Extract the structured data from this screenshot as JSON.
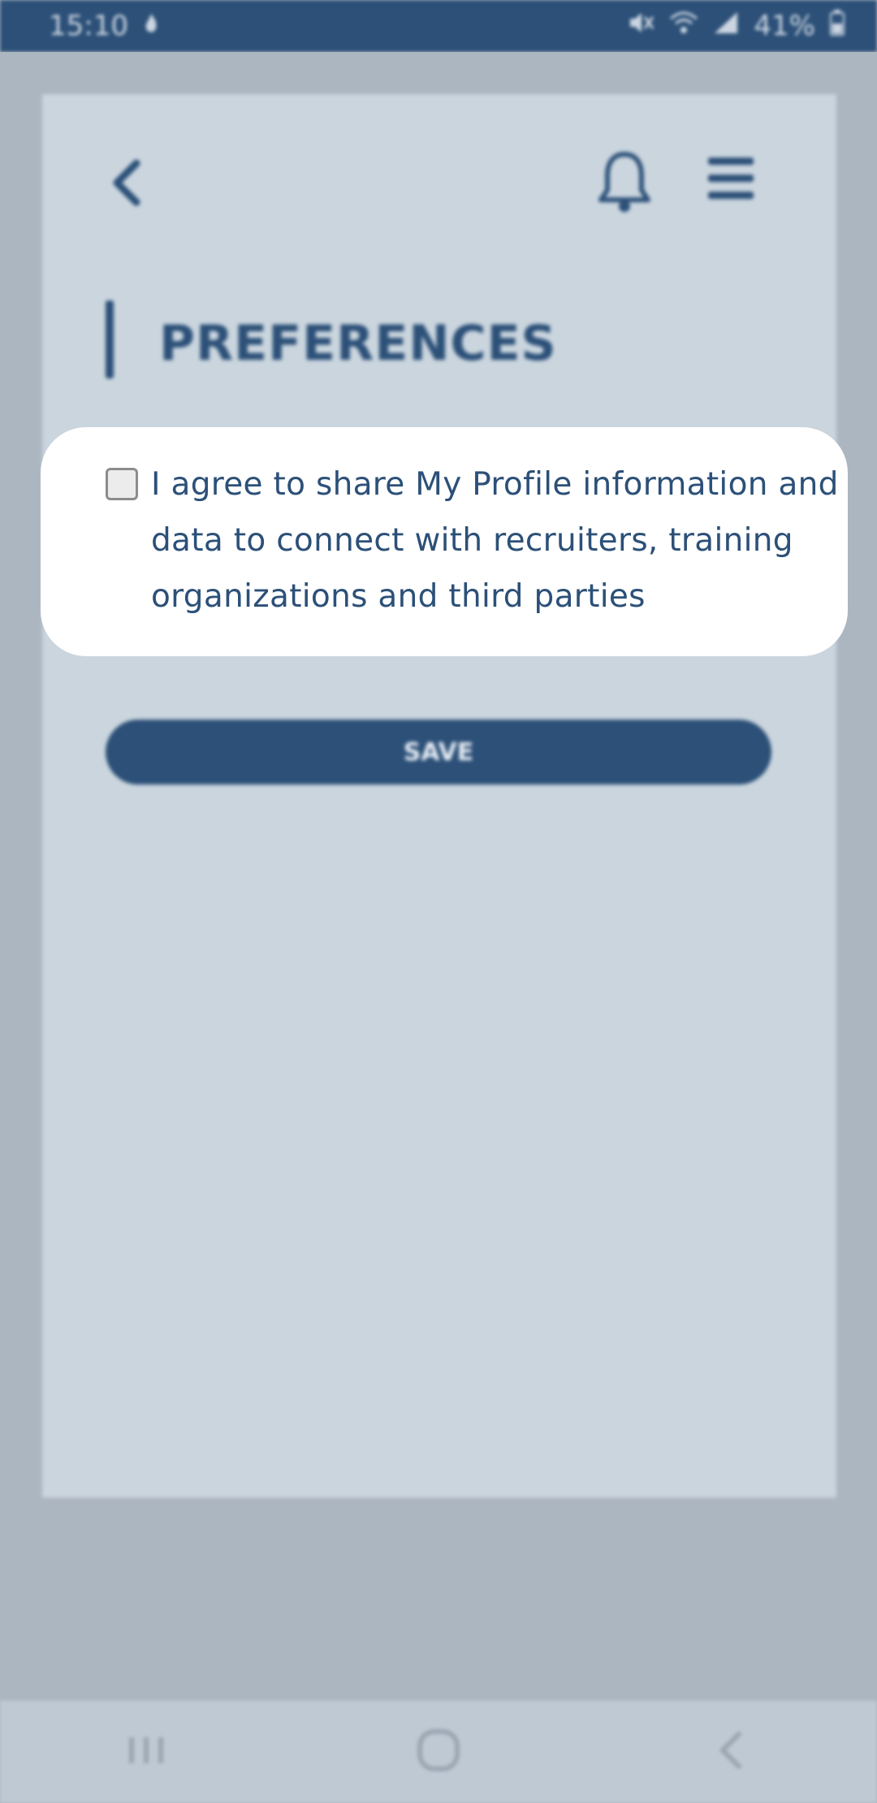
{
  "status_bar": {
    "time": "15:10",
    "battery": "41%"
  },
  "header": {
    "back_icon": "chevron-left-icon",
    "notification_icon": "bell-icon",
    "menu_icon": "hamburger-menu-icon"
  },
  "page": {
    "title": "PREFERENCES"
  },
  "consent": {
    "checked": false,
    "label": "I agree to share My Profile information and data to connect with recruiters, training organizations and third parties"
  },
  "actions": {
    "save_label": "SAVE"
  },
  "navigation_bar": {
    "recents_icon": "recents-icon",
    "home_icon": "home-icon",
    "back_icon": "back-icon"
  },
  "colors": {
    "primary": "#2c5078",
    "dim_overlay": "#acb6c0",
    "card": "#cad5de",
    "highlight": "#ffffff"
  }
}
